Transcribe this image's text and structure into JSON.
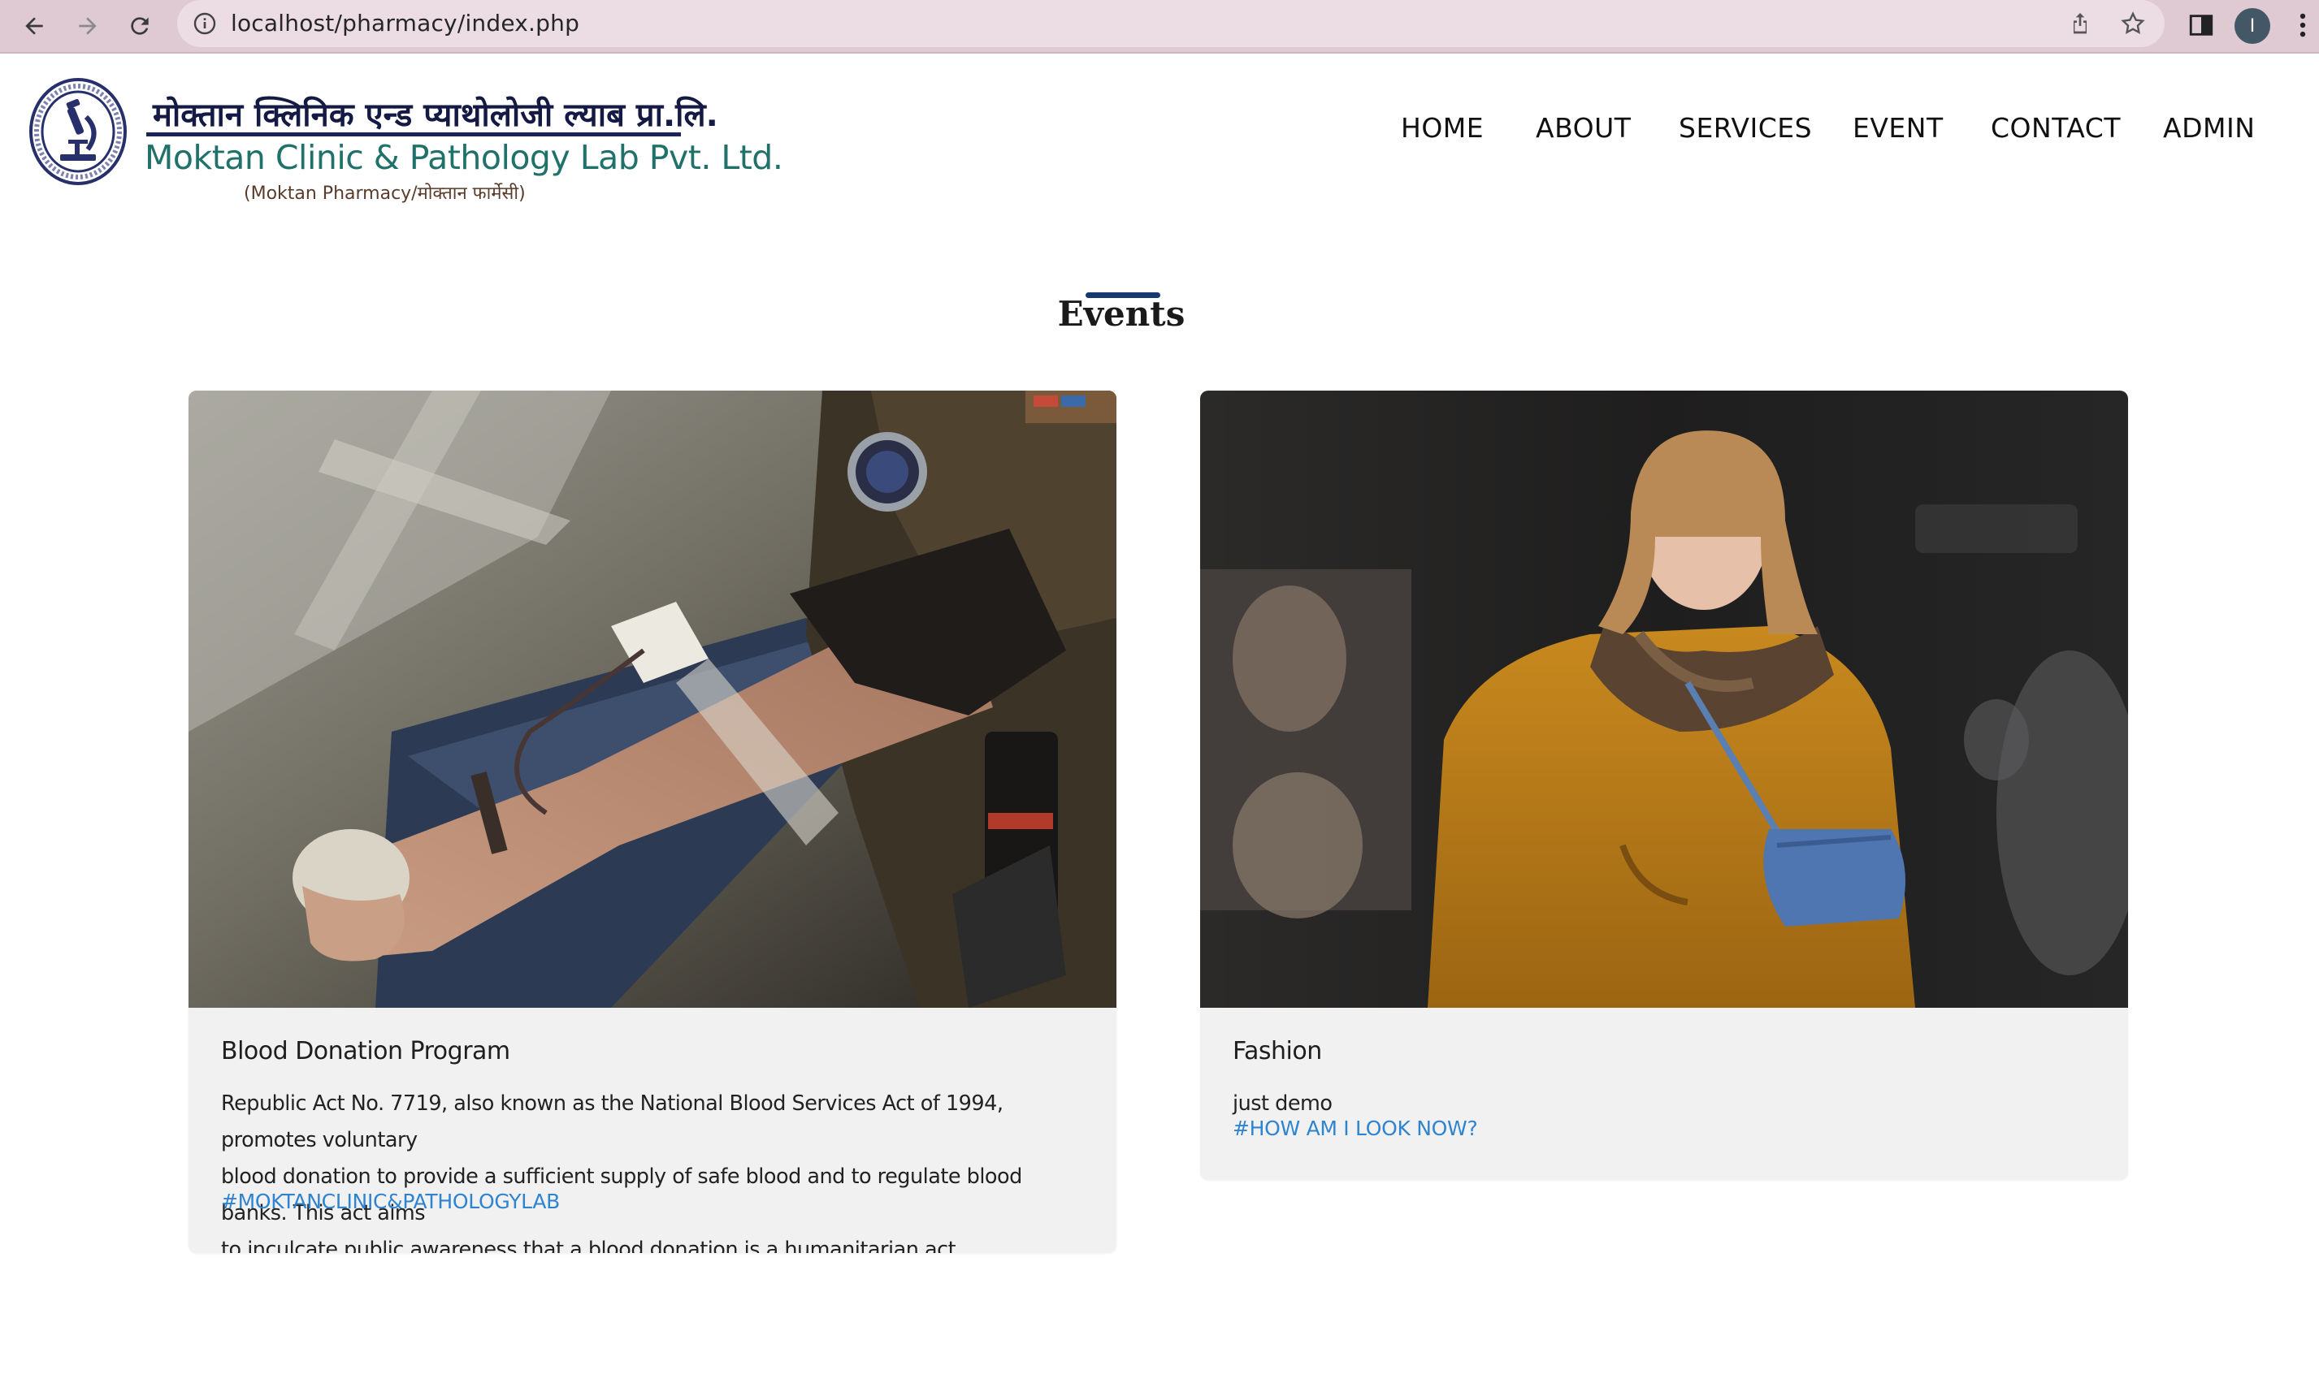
{
  "browser": {
    "url": "localhost/pharmacy/index.php",
    "profile_initial": "I",
    "icons": [
      "back-arrow-icon",
      "forward-arrow-icon",
      "reload-icon",
      "info-icon",
      "share-icon",
      "bookmark-star-icon",
      "side-panel-icon",
      "kebab-menu-icon"
    ]
  },
  "brand": {
    "name_nepali": "मोक्तान क्लिनिक एन्ड प्याथोलोजी ल्याब प्रा.लि.",
    "name_english": "Moktan Clinic & Pathology Lab Pvt. Ltd.",
    "subtitle": "(Moktan Pharmacy/मोक्तान फार्मेसी)"
  },
  "nav": {
    "home": "HOME",
    "about": "ABOUT",
    "services": "SERVICES",
    "event": "EVENT",
    "contact": "CONTACT",
    "admin": "ADMIN"
  },
  "events_section": {
    "title": "Events",
    "accent_color": "#163a70",
    "cards": [
      {
        "title": "Blood Donation Program",
        "lines": [
          "Republic Act No. 7719, also known as the National Blood Services Act of 1994, promotes voluntary",
          "blood donation to provide a sufficient supply of safe blood and to regulate blood banks. This act aims",
          "to inculcate public awareness that a blood donation is a humanitarian act."
        ],
        "tag": "#MOKTANCLINIC&PATHOLOGYLAB"
      },
      {
        "title": "Fashion",
        "lines": [
          "just demo"
        ],
        "tag": "#HOW AM I LOOK NOW?"
      }
    ]
  },
  "colors": {
    "chrome_bg": "#dfc9d3",
    "card_bg": "#f1f1f1",
    "link": "#2f84cf",
    "brand_navy": "#151a45",
    "brand_teal": "#1f7169"
  }
}
